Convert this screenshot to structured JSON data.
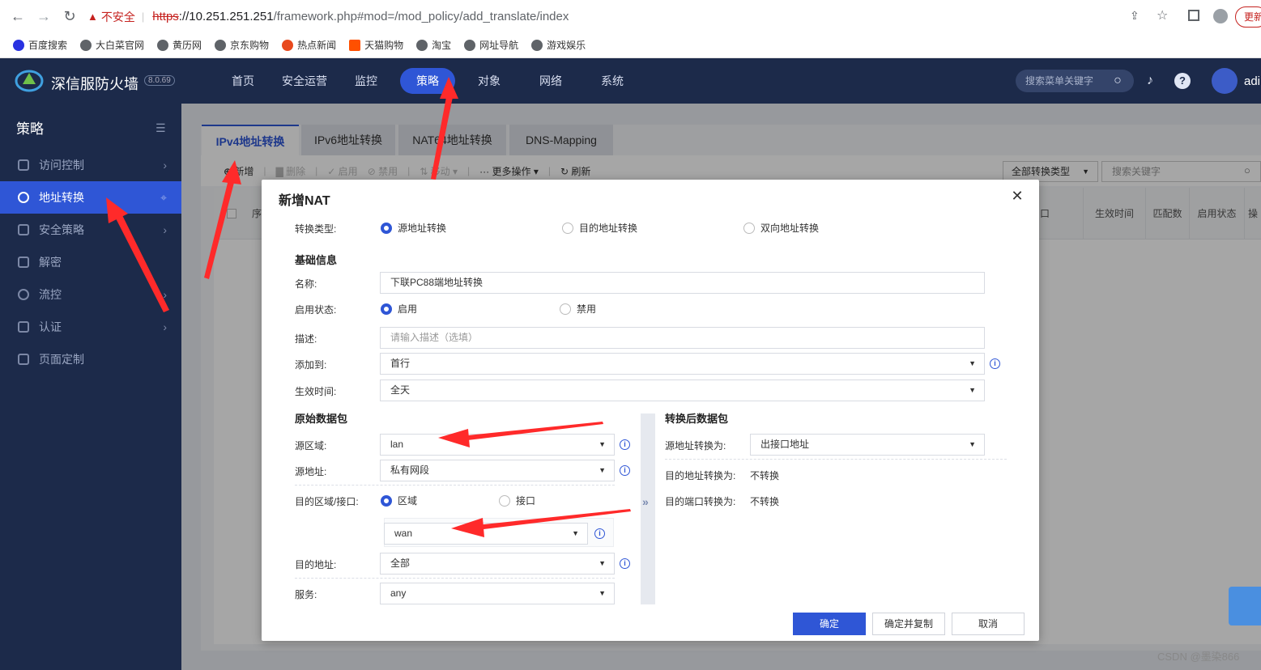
{
  "browser": {
    "insecure_label": "不安全",
    "url_scheme": "https",
    "url_host": "://10.251.251.251",
    "url_path": "/framework.php#mod=/mod_policy/add_translate/index",
    "update_label": "更新",
    "bookmarks": [
      "百度搜索",
      "大白菜官网",
      "黄历网",
      "京东购物",
      "热点新闻",
      "天猫购物",
      "淘宝",
      "网址导航",
      "游戏娱乐"
    ]
  },
  "app": {
    "brand": "深信服防火墙",
    "version": "8.0.69",
    "nav": [
      "首页",
      "安全运营",
      "监控",
      "策略",
      "对象",
      "网络",
      "系统"
    ],
    "search_placeholder": "搜索菜单关键字",
    "user": "adi"
  },
  "sidebar": {
    "title": "策略",
    "items": [
      {
        "label": "访问控制"
      },
      {
        "label": "地址转换"
      },
      {
        "label": "安全策略"
      },
      {
        "label": "解密"
      },
      {
        "label": "流控"
      },
      {
        "label": "认证"
      },
      {
        "label": "页面定制"
      }
    ]
  },
  "tabs": [
    "IPv4地址转换",
    "IPv6地址转换",
    "NAT64地址转换",
    "DNS-Mapping"
  ],
  "toolbar": {
    "new": "新增",
    "delete": "删除",
    "enable": "启用",
    "disable": "禁用",
    "move": "移动",
    "more": "更多操作",
    "refresh": "刷新",
    "type_filter": "全部转换类型",
    "keyword_placeholder": "搜索关键字"
  },
  "table": {
    "col_partial_left": "序",
    "col_partial_mid": "口",
    "cols": [
      "生效时间",
      "匹配数",
      "启用状态",
      "操"
    ]
  },
  "modal": {
    "title": "新增NAT",
    "type_label": "转换类型:",
    "type_options": [
      "源地址转换",
      "目的地址转换",
      "双向地址转换"
    ],
    "basic_section": "基础信息",
    "name_label": "名称:",
    "name_value": "下联PC88端地址转换",
    "status_label": "启用状态:",
    "status_options": [
      "启用",
      "禁用"
    ],
    "desc_label": "描述:",
    "desc_placeholder": "请输入描述（选填）",
    "addto_label": "添加到:",
    "addto_value": "首行",
    "time_label": "生效时间:",
    "time_value": "全天",
    "orig_section": "原始数据包",
    "src_zone_label": "源区域:",
    "src_zone_value": "lan",
    "src_addr_label": "源地址:",
    "src_addr_value": "私有网段",
    "dst_zone_label": "目的区域/接口:",
    "dst_zone_options": [
      "区域",
      "接口"
    ],
    "dst_zone_value": "wan",
    "dst_addr_label": "目的地址:",
    "dst_addr_value": "全部",
    "service_label": "服务:",
    "service_value": "any",
    "trans_section": "转换后数据包",
    "src_trans_label": "源地址转换为:",
    "src_trans_value": "出接口地址",
    "dst_trans_label": "目的地址转换为:",
    "dst_trans_value": "不转换",
    "port_trans_label": "目的端口转换为:",
    "port_trans_value": "不转换",
    "ok": "确定",
    "ok_copy": "确定并复制",
    "cancel": "取消"
  },
  "watermark": "CSDN @墨染866",
  "colors": {
    "accent": "#2f56d6",
    "nav_bg": "#1c2a4a",
    "annotation": "#ff2a2a"
  }
}
